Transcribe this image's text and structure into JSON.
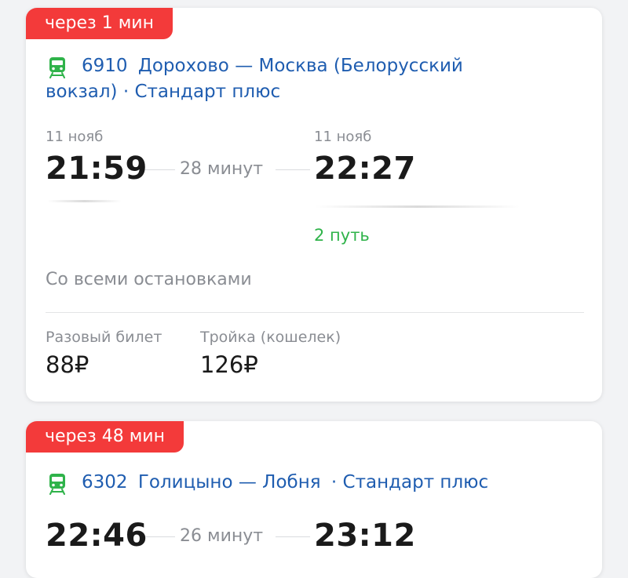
{
  "trains": [
    {
      "badge": "через 1 мин",
      "number": "6910",
      "route_line1": "Дорохово — Москва (Белорусский",
      "route_line2": "вокзал) · Стандарт плюс",
      "departure": {
        "date": "11 нояб",
        "time": "21:59"
      },
      "duration": "28 минут",
      "arrival": {
        "date": "11 нояб",
        "time": "22:27",
        "platform": "2 путь"
      },
      "stops": "Со всеми остановками",
      "prices": [
        {
          "label": "Разовый билет",
          "value": "88₽"
        },
        {
          "label": "Тройка (кошелек)",
          "value": "126₽"
        }
      ]
    },
    {
      "badge": "через 48 мин",
      "number": "6302",
      "route_line1": "Голицыно — Лобня",
      "route_suffix": "· Стандарт плюс",
      "departure": {
        "time": "22:46"
      },
      "duration": "26 минут",
      "arrival": {
        "time": "23:12"
      }
    }
  ],
  "colors": {
    "badge": "#f33a3a",
    "route_link": "#1f5db0",
    "train_icon": "#2fb34a",
    "platform": "#2fb34a"
  },
  "icons": {
    "train": "train-icon"
  }
}
